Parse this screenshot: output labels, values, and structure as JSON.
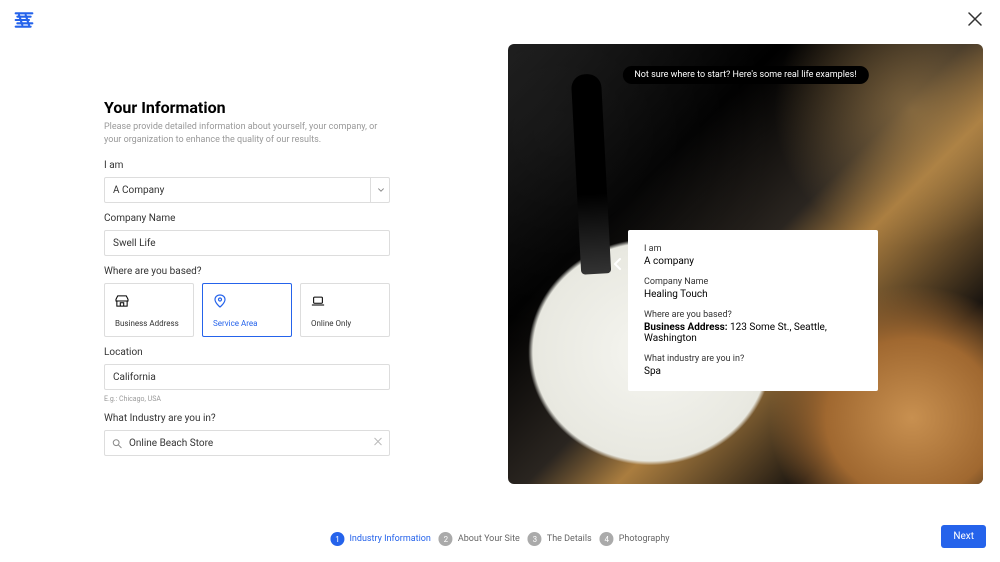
{
  "header": {
    "close_label": "×"
  },
  "form": {
    "title": "Your Information",
    "subtitle": "Please provide detailed information about yourself, your company, or your organization to enhance the quality of our results.",
    "i_am": {
      "label": "I am",
      "value": "A Company"
    },
    "company_name": {
      "label": "Company Name",
      "value": "Swell Life"
    },
    "based": {
      "label": "Where are you based?",
      "options": [
        {
          "label": "Business Address",
          "icon": "storefront-icon",
          "selected": false
        },
        {
          "label": "Service Area",
          "icon": "pin-icon",
          "selected": true
        },
        {
          "label": "Online Only",
          "icon": "laptop-icon",
          "selected": false
        }
      ]
    },
    "location": {
      "label": "Location",
      "value": "California",
      "hint": "E.g.: Chicago, USA"
    },
    "industry": {
      "label": "What Industry are you in?",
      "value": "Online Beach Store"
    }
  },
  "preview": {
    "banner": "Not sure where to start? Here's some real life examples!",
    "example": {
      "iam_label": "I am",
      "iam_value": "A company",
      "company_label": "Company Name",
      "company_value": "Healing Touch",
      "based_label": "Where are you based?",
      "based_key": "Business Address:",
      "based_value": " 123 Some St., Seattle, Washington",
      "industry_label": "What industry are you in?",
      "industry_value": "Spa"
    }
  },
  "stepper": {
    "steps": [
      {
        "num": "1",
        "label": "Industry Information",
        "active": true
      },
      {
        "num": "2",
        "label": "About Your Site",
        "active": false
      },
      {
        "num": "3",
        "label": "The Details",
        "active": false
      },
      {
        "num": "4",
        "label": "Photography",
        "active": false
      }
    ]
  },
  "buttons": {
    "next": "Next"
  }
}
